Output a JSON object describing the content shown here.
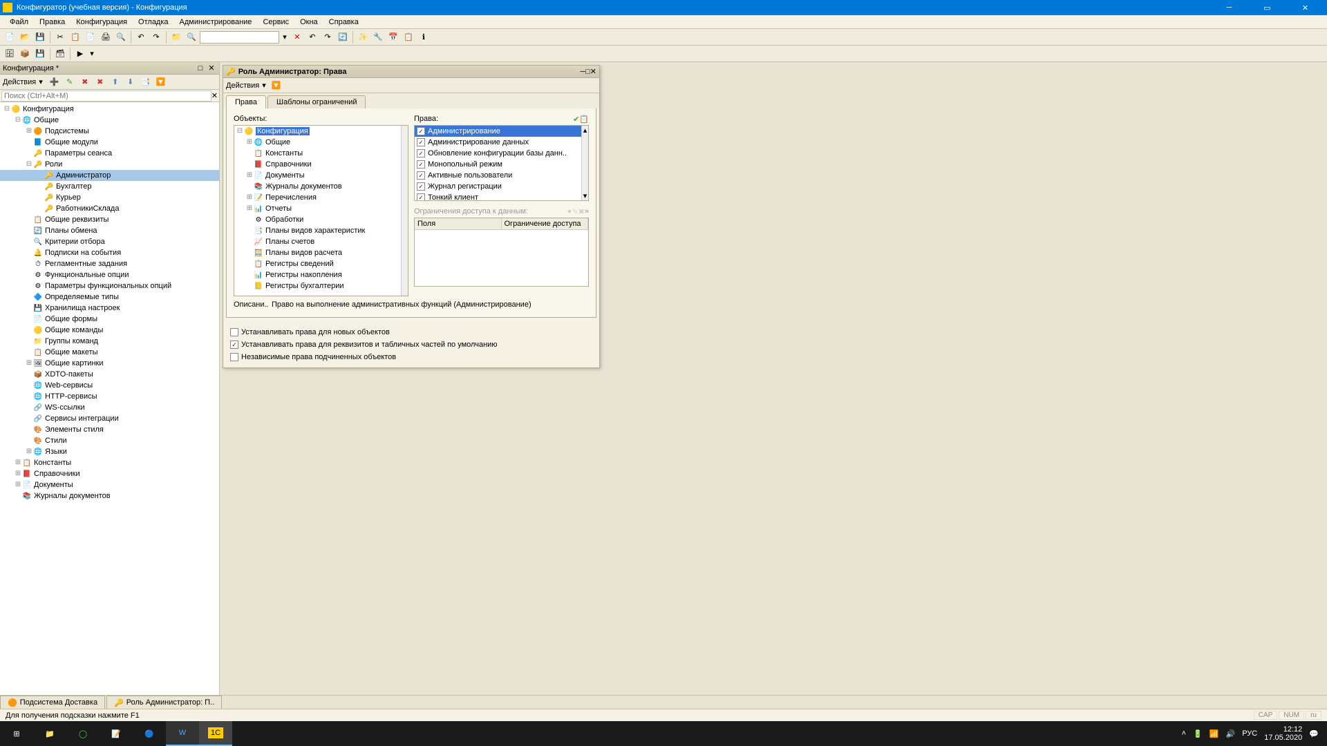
{
  "titlebar": {
    "title": "Конфигуратор (учебная версия) - Конфигурация"
  },
  "menu": [
    "Файл",
    "Правка",
    "Конфигурация",
    "Отладка",
    "Администрирование",
    "Сервис",
    "Окна",
    "Справка"
  ],
  "sidebar": {
    "title": "Конфигурация *",
    "actions_label": "Действия",
    "search_placeholder": "Поиск (Ctrl+Alt+M)",
    "tree": [
      {
        "label": "Конфигурация",
        "depth": 0,
        "toggle": "-",
        "icon": "🟡"
      },
      {
        "label": "Общие",
        "depth": 1,
        "toggle": "-",
        "icon": "🌐"
      },
      {
        "label": "Подсистемы",
        "depth": 2,
        "toggle": "+",
        "icon": "🟠"
      },
      {
        "label": "Общие модули",
        "depth": 2,
        "toggle": "",
        "icon": "📘"
      },
      {
        "label": "Параметры сеанса",
        "depth": 2,
        "toggle": "",
        "icon": "🔑"
      },
      {
        "label": "Роли",
        "depth": 2,
        "toggle": "-",
        "icon": "🔑"
      },
      {
        "label": "Администратор",
        "depth": 3,
        "toggle": "",
        "icon": "🔑",
        "selected": true
      },
      {
        "label": "Бухгалтер",
        "depth": 3,
        "toggle": "",
        "icon": "🔑"
      },
      {
        "label": "Курьер",
        "depth": 3,
        "toggle": "",
        "icon": "🔑"
      },
      {
        "label": "РаботникиСклада",
        "depth": 3,
        "toggle": "",
        "icon": "🔑"
      },
      {
        "label": "Общие реквизиты",
        "depth": 2,
        "toggle": "",
        "icon": "📋"
      },
      {
        "label": "Планы обмена",
        "depth": 2,
        "toggle": "",
        "icon": "🔄"
      },
      {
        "label": "Критерии отбора",
        "depth": 2,
        "toggle": "",
        "icon": "🔍"
      },
      {
        "label": "Подписки на события",
        "depth": 2,
        "toggle": "",
        "icon": "🔔"
      },
      {
        "label": "Регламентные задания",
        "depth": 2,
        "toggle": "",
        "icon": "⏱"
      },
      {
        "label": "Функциональные опции",
        "depth": 2,
        "toggle": "",
        "icon": "⚙"
      },
      {
        "label": "Параметры функциональных опций",
        "depth": 2,
        "toggle": "",
        "icon": "⚙"
      },
      {
        "label": "Определяемые типы",
        "depth": 2,
        "toggle": "",
        "icon": "🔷"
      },
      {
        "label": "Хранилища настроек",
        "depth": 2,
        "toggle": "",
        "icon": "💾"
      },
      {
        "label": "Общие формы",
        "depth": 2,
        "toggle": "",
        "icon": "📄"
      },
      {
        "label": "Общие команды",
        "depth": 2,
        "toggle": "",
        "icon": "🟡"
      },
      {
        "label": "Группы команд",
        "depth": 2,
        "toggle": "",
        "icon": "📁"
      },
      {
        "label": "Общие макеты",
        "depth": 2,
        "toggle": "",
        "icon": "📋"
      },
      {
        "label": "Общие картинки",
        "depth": 2,
        "toggle": "+",
        "icon": "🖼"
      },
      {
        "label": "XDTO-пакеты",
        "depth": 2,
        "toggle": "",
        "icon": "📦"
      },
      {
        "label": "Web-сервисы",
        "depth": 2,
        "toggle": "",
        "icon": "🌐"
      },
      {
        "label": "HTTP-сервисы",
        "depth": 2,
        "toggle": "",
        "icon": "🌐"
      },
      {
        "label": "WS-ссылки",
        "depth": 2,
        "toggle": "",
        "icon": "🔗"
      },
      {
        "label": "Сервисы интеграции",
        "depth": 2,
        "toggle": "",
        "icon": "🔗"
      },
      {
        "label": "Элементы стиля",
        "depth": 2,
        "toggle": "",
        "icon": "🎨"
      },
      {
        "label": "Стили",
        "depth": 2,
        "toggle": "",
        "icon": "🎨"
      },
      {
        "label": "Языки",
        "depth": 2,
        "toggle": "+",
        "icon": "🌐"
      },
      {
        "label": "Константы",
        "depth": 1,
        "toggle": "+",
        "icon": "📋"
      },
      {
        "label": "Справочники",
        "depth": 1,
        "toggle": "+",
        "icon": "📕"
      },
      {
        "label": "Документы",
        "depth": 1,
        "toggle": "+",
        "icon": "📄"
      },
      {
        "label": "Журналы документов",
        "depth": 1,
        "toggle": "",
        "icon": "📚"
      }
    ]
  },
  "role_window": {
    "title": "Роль Администратор: Права",
    "actions_label": "Действия",
    "tabs": [
      "Права",
      "Шаблоны ограничений"
    ],
    "active_tab": 0,
    "objects_label": "Объекты:",
    "rights_label": "Права:",
    "objects": [
      {
        "label": "Конфигурация",
        "toggle": "-",
        "icon": "🟡",
        "depth": 0,
        "selected": true
      },
      {
        "label": "Общие",
        "toggle": "+",
        "icon": "🌐",
        "depth": 1
      },
      {
        "label": "Константы",
        "toggle": "",
        "icon": "📋",
        "depth": 1
      },
      {
        "label": "Справочники",
        "toggle": "",
        "icon": "📕",
        "depth": 1
      },
      {
        "label": "Документы",
        "toggle": "+",
        "icon": "📄",
        "depth": 1
      },
      {
        "label": "Журналы документов",
        "toggle": "",
        "icon": "📚",
        "depth": 1
      },
      {
        "label": "Перечисления",
        "toggle": "+",
        "icon": "📝",
        "depth": 1
      },
      {
        "label": "Отчеты",
        "toggle": "+",
        "icon": "📊",
        "depth": 1
      },
      {
        "label": "Обработки",
        "toggle": "",
        "icon": "⚙",
        "depth": 1
      },
      {
        "label": "Планы видов характеристик",
        "toggle": "",
        "icon": "📑",
        "depth": 1
      },
      {
        "label": "Планы счетов",
        "toggle": "",
        "icon": "📈",
        "depth": 1
      },
      {
        "label": "Планы видов расчета",
        "toggle": "",
        "icon": "🧮",
        "depth": 1
      },
      {
        "label": "Регистры сведений",
        "toggle": "",
        "icon": "📋",
        "depth": 1
      },
      {
        "label": "Регистры накопления",
        "toggle": "",
        "icon": "📊",
        "depth": 1
      },
      {
        "label": "Регистры бухгалтерии",
        "toggle": "",
        "icon": "📒",
        "depth": 1
      }
    ],
    "rights": [
      {
        "label": "Администрирование",
        "checked": true,
        "selected": true
      },
      {
        "label": "Администрирование данных",
        "checked": true
      },
      {
        "label": "Обновление конфигурации базы данн..",
        "checked": true
      },
      {
        "label": "Монопольный режим",
        "checked": true
      },
      {
        "label": "Активные пользователи",
        "checked": true
      },
      {
        "label": "Журнал регистрации",
        "checked": true
      },
      {
        "label": "Тонкий клиент",
        "checked": true
      }
    ],
    "restrictions_label": "Ограничения доступа к данным:",
    "restrict_cols": [
      "Поля",
      "Ограничение доступа"
    ],
    "desc_label": "Описани..",
    "desc_text": "Право на выполнение административных функций (Администрирование)",
    "checks": [
      {
        "label": "Устанавливать права для новых объектов",
        "checked": false
      },
      {
        "label": "Устанавливать права для реквизитов и табличных частей по умолчанию",
        "checked": true
      },
      {
        "label": "Независимые права подчиненных объектов",
        "checked": false
      }
    ]
  },
  "bottom_tabs": [
    "Подсистема Доставка",
    "Роль Администратор: П.."
  ],
  "status_hint": "Для получения подсказки нажмите F1",
  "status_right": [
    "CAP",
    "NUM",
    "ru"
  ],
  "tray": {
    "lang": "РУС",
    "time": "12:12",
    "date": "17.05.2020"
  }
}
